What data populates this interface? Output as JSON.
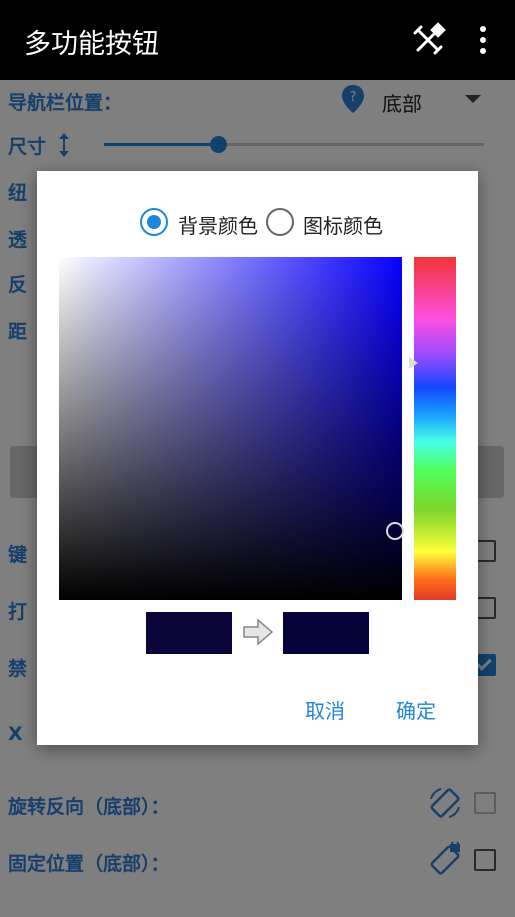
{
  "appbar": {
    "title": "多功能按钮",
    "tool_icon": "tools-icon",
    "more_icon": "more-vert-icon"
  },
  "settings": {
    "nav_position_label": "导航栏位置：",
    "nav_position_value": "底部",
    "size_label": "尺寸",
    "size_slider_fraction": 0.3,
    "partial_labels": [
      "纽",
      "透",
      "反",
      "距"
    ],
    "keyboard_label": "键",
    "open_label": "打",
    "disable_label": "禁",
    "x_label": "X",
    "rotate_reverse_label": "旋转反向（底部）：",
    "fixed_position_label": "固定位置（底部）：",
    "checkboxes": {
      "keyboard": false,
      "open": false,
      "disable": true,
      "rotate_reverse": false,
      "fixed_position": false
    }
  },
  "dialog": {
    "radio_background": "背景颜色",
    "radio_icon": "图标颜色",
    "selected_radio": "背景颜色",
    "old_color": "#0a0438",
    "new_color": "#06023a",
    "cancel_label": "取消",
    "ok_label": "确定",
    "hue_fraction": 0.31,
    "saturation": 0.98,
    "brightness": 0.2
  },
  "colors": {
    "accent": "#1f86d8",
    "appbar": "#000000",
    "label_blue": "#2f7fd8"
  }
}
